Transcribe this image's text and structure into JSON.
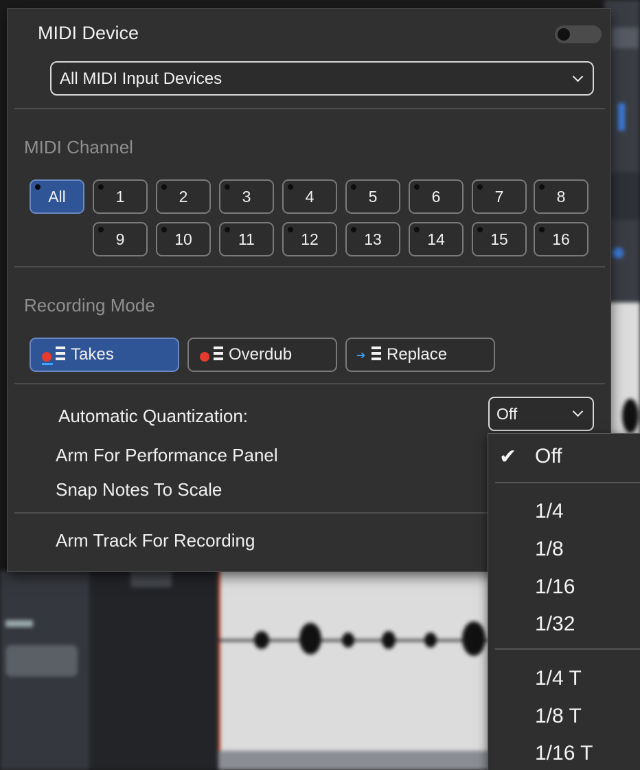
{
  "midi_device": {
    "title": "MIDI Device",
    "toggle_on": false,
    "selected_device": "All MIDI Input Devices"
  },
  "midi_channel": {
    "title": "MIDI Channel",
    "all_label": "All",
    "channels": [
      "1",
      "2",
      "3",
      "4",
      "5",
      "6",
      "7",
      "8",
      "9",
      "10",
      "11",
      "12",
      "13",
      "14",
      "15",
      "16"
    ],
    "selected": "All"
  },
  "recording_mode": {
    "title": "Recording Mode",
    "modes": [
      "Takes",
      "Overdub",
      "Replace"
    ],
    "selected": "Takes"
  },
  "options": {
    "auto_quant_label": "Automatic Quantization:",
    "auto_quant_value": "Off",
    "arm_performance_label": "Arm For Performance Panel",
    "snap_notes_label": "Snap Notes To Scale",
    "arm_track_label": "Arm Track For Recording"
  },
  "quant_menu": {
    "check_glyph": "✔",
    "items": [
      "Off",
      "1/4",
      "1/8",
      "1/16",
      "1/32",
      "1/4 T",
      "1/8 T",
      "1/16 T"
    ],
    "checked": "Off"
  },
  "colors": {
    "accent": "#2f5596",
    "record_red": "#e53b2f",
    "replace_blue": "#3aa4ff"
  }
}
